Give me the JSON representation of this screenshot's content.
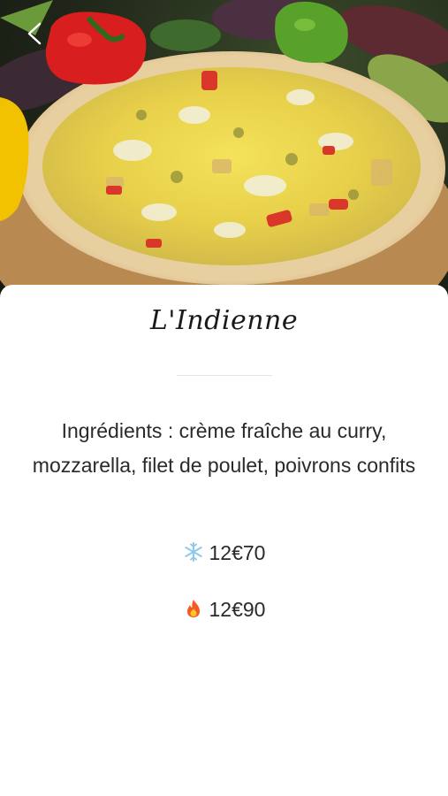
{
  "product": {
    "name": "L'Indienne",
    "ingredients": "Ingrédients : crème fraîche au curry, mozzarella, filet de poulet, poivrons confits"
  },
  "prices": [
    {
      "icon": "snowflake-icon",
      "label": "12€70"
    },
    {
      "icon": "fire-icon",
      "label": "12€90"
    }
  ],
  "colors": {
    "text": "#2a2a2a",
    "snowflake": "#8ec8ea",
    "fire": "#f25c1f"
  }
}
